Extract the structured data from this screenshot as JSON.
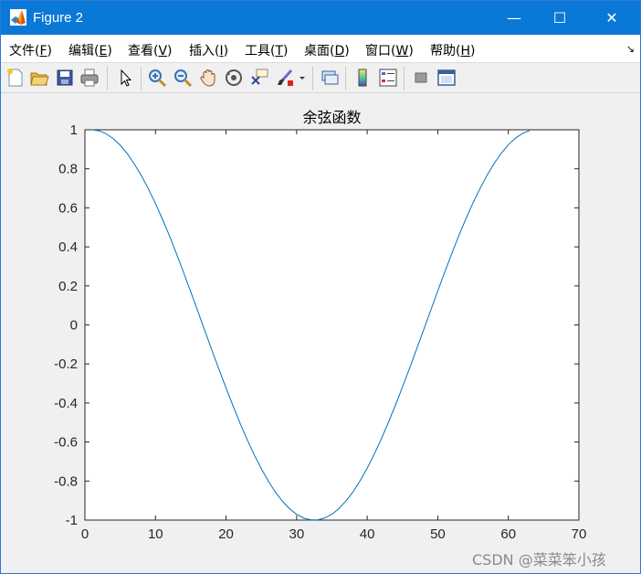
{
  "window": {
    "title": "Figure 2",
    "controls": {
      "minimize": "—",
      "maximize": "☐",
      "close": "✕"
    }
  },
  "menu": {
    "items": [
      {
        "label": "文件(",
        "key": "F",
        "suffix": ")"
      },
      {
        "label": "编辑(",
        "key": "E",
        "suffix": ")"
      },
      {
        "label": "查看(",
        "key": "V",
        "suffix": ")"
      },
      {
        "label": "插入(",
        "key": "I",
        "suffix": ")"
      },
      {
        "label": "工具(",
        "key": "T",
        "suffix": ")"
      },
      {
        "label": "桌面(",
        "key": "D",
        "suffix": ")"
      },
      {
        "label": "窗口(",
        "key": "W",
        "suffix": ")"
      },
      {
        "label": "帮助(",
        "key": "H",
        "suffix": ")"
      }
    ],
    "overflow_icon": "↘"
  },
  "toolbar": {
    "icons": [
      "new-figure-icon",
      "open-file-icon",
      "save-icon",
      "print-icon",
      "pointer-icon",
      "zoom-in-icon",
      "zoom-out-icon",
      "pan-hand-icon",
      "rotate-3d-icon",
      "data-cursor-icon",
      "brush-icon",
      "dropdown-arrow-icon",
      "link-plot-icon",
      "colorbar-icon",
      "legend-icon",
      "hide-plot-tools-icon",
      "show-plot-tools-icon"
    ]
  },
  "watermark": "CSDN @菜菜笨小孩",
  "chart_data": {
    "type": "line",
    "title": "余弦函数",
    "xlabel": "",
    "ylabel": "",
    "xlim": [
      0,
      70
    ],
    "ylim": [
      -1,
      1
    ],
    "xticks": [
      "0",
      "10",
      "20",
      "30",
      "40",
      "50",
      "60",
      "70"
    ],
    "yticks": [
      "1",
      "0.8",
      "0.6",
      "0.4",
      "0.2",
      "0",
      "-0.2",
      "-0.4",
      "-0.6",
      "-0.8",
      "-1"
    ],
    "grid": false,
    "series": [
      {
        "color": "#0072bd",
        "x": [
          1,
          2,
          3,
          4,
          5,
          6,
          7,
          8,
          9,
          10,
          11,
          12,
          13,
          14,
          15,
          16,
          17,
          18,
          19,
          20,
          21,
          22,
          23,
          24,
          25,
          26,
          27,
          28,
          29,
          30,
          31,
          32,
          33,
          34,
          35,
          36,
          37,
          38,
          39,
          40,
          41,
          42,
          43,
          44,
          45,
          46,
          47,
          48,
          49,
          50,
          51,
          52,
          53,
          54,
          55,
          56,
          57,
          58,
          59,
          60,
          61,
          62,
          63
        ],
        "y": [
          1.0,
          0.995,
          0.98,
          0.955,
          0.921,
          0.878,
          0.825,
          0.765,
          0.697,
          0.622,
          0.541,
          0.455,
          0.362,
          0.267,
          0.169,
          0.07,
          -0.03,
          -0.13,
          -0.228,
          -0.323,
          -0.416,
          -0.505,
          -0.588,
          -0.666,
          -0.737,
          -0.801,
          -0.857,
          -0.904,
          -0.942,
          -0.971,
          -0.99,
          -0.999,
          -0.999,
          -0.989,
          -0.97,
          -0.941,
          -0.902,
          -0.855,
          -0.798,
          -0.734,
          -0.662,
          -0.584,
          -0.5,
          -0.411,
          -0.318,
          -0.223,
          -0.124,
          -0.025,
          0.075,
          0.174,
          0.272,
          0.367,
          0.459,
          0.545,
          0.626,
          0.7,
          0.768,
          0.828,
          0.88,
          0.923,
          0.957,
          0.981,
          0.996
        ]
      }
    ]
  }
}
